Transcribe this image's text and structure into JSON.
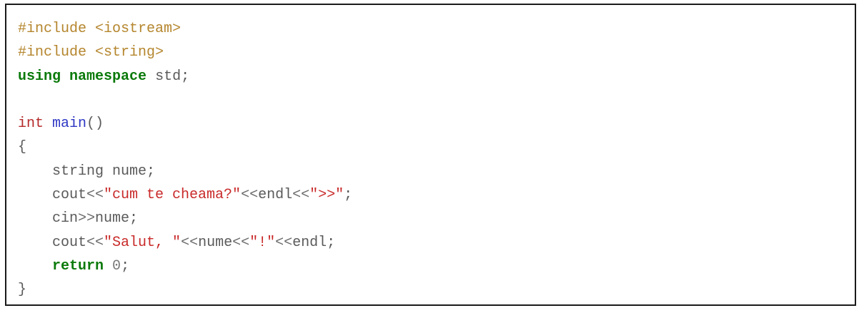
{
  "code": {
    "lines": [
      [
        {
          "cls": "tok-pp",
          "text": "#include <iostream>"
        }
      ],
      [
        {
          "cls": "tok-pp",
          "text": "#include <string>"
        }
      ],
      [
        {
          "cls": "tok-kw",
          "text": "using"
        },
        {
          "cls": "tok-id",
          "text": " "
        },
        {
          "cls": "tok-kw",
          "text": "namespace"
        },
        {
          "cls": "tok-id",
          "text": " std;"
        }
      ],
      [],
      [
        {
          "cls": "tok-type",
          "text": "int"
        },
        {
          "cls": "tok-id",
          "text": " "
        },
        {
          "cls": "tok-fn",
          "text": "main"
        },
        {
          "cls": "tok-punct",
          "text": "()"
        }
      ],
      [
        {
          "cls": "tok-punct",
          "text": "{"
        }
      ],
      [
        {
          "cls": "tok-id",
          "text": "    string nume;"
        }
      ],
      [
        {
          "cls": "tok-id",
          "text": "    cout"
        },
        {
          "cls": "tok-op",
          "text": "<<"
        },
        {
          "cls": "tok-str",
          "text": "\"cum te cheama?\""
        },
        {
          "cls": "tok-op",
          "text": "<<"
        },
        {
          "cls": "tok-id",
          "text": "endl"
        },
        {
          "cls": "tok-op",
          "text": "<<"
        },
        {
          "cls": "tok-str",
          "text": "\">>\""
        },
        {
          "cls": "tok-punct",
          "text": ";"
        }
      ],
      [
        {
          "cls": "tok-id",
          "text": "    cin"
        },
        {
          "cls": "tok-op",
          "text": ">>"
        },
        {
          "cls": "tok-id",
          "text": "nume;"
        }
      ],
      [
        {
          "cls": "tok-id",
          "text": "    cout"
        },
        {
          "cls": "tok-op",
          "text": "<<"
        },
        {
          "cls": "tok-str",
          "text": "\"Salut, \""
        },
        {
          "cls": "tok-op",
          "text": "<<"
        },
        {
          "cls": "tok-id",
          "text": "nume"
        },
        {
          "cls": "tok-op",
          "text": "<<"
        },
        {
          "cls": "tok-str",
          "text": "\"!\""
        },
        {
          "cls": "tok-op",
          "text": "<<"
        },
        {
          "cls": "tok-id",
          "text": "endl;"
        }
      ],
      [
        {
          "cls": "tok-id",
          "text": "    "
        },
        {
          "cls": "tok-kw",
          "text": "return"
        },
        {
          "cls": "tok-id",
          "text": " "
        },
        {
          "cls": "tok-num",
          "text": "0"
        },
        {
          "cls": "tok-punct",
          "text": ";"
        }
      ],
      [
        {
          "cls": "tok-punct",
          "text": "}"
        }
      ]
    ]
  }
}
